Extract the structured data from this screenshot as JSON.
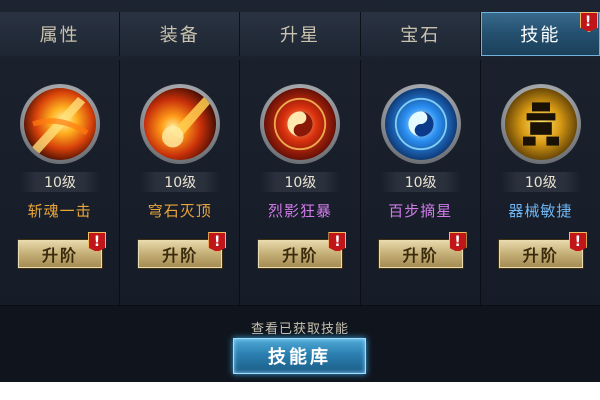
{
  "tabs": [
    {
      "label": "属性",
      "active": false,
      "alert": false
    },
    {
      "label": "装备",
      "active": false,
      "alert": false
    },
    {
      "label": "升星",
      "active": false,
      "alert": false
    },
    {
      "label": "宝石",
      "active": false,
      "alert": false
    },
    {
      "label": "技能",
      "active": true,
      "alert": true
    }
  ],
  "alert_mark": "!",
  "skills": [
    {
      "name": "斩魂一击",
      "level": "10级",
      "name_color": "#e8a53a",
      "icon": "fire-slash-icon"
    },
    {
      "name": "穹石灭顶",
      "level": "10级",
      "name_color": "#e8a53a",
      "icon": "meteor-icon"
    },
    {
      "name": "烈影狂暴",
      "level": "10级",
      "name_color": "#d07be8",
      "icon": "red-yinyang-icon"
    },
    {
      "name": "百步摘星",
      "level": "10级",
      "name_color": "#d07be8",
      "icon": "blue-yinyang-icon"
    },
    {
      "name": "器械敏捷",
      "level": "10级",
      "name_color": "#6fb6f2",
      "icon": "gear-totem-icon"
    }
  ],
  "upgrade_label": "升阶",
  "view_acquired_text": "查看已获取技能",
  "skill_library_label": "技能库"
}
